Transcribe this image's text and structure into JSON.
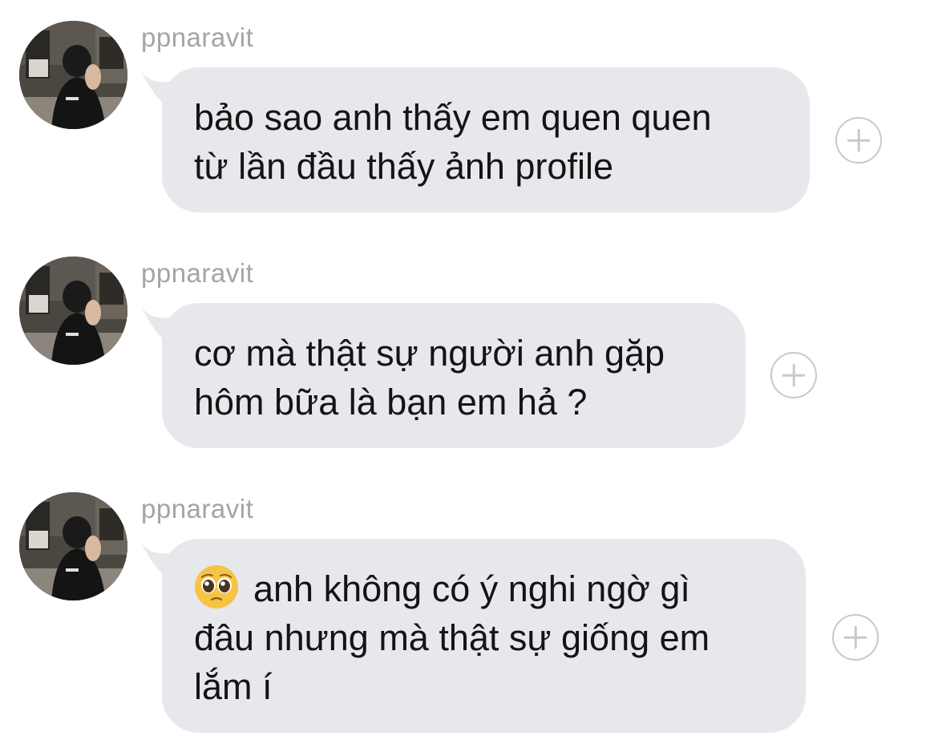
{
  "chat": {
    "messages": [
      {
        "sender": "ppnaravit",
        "text": "bảo sao anh thấy em quen quen\ntừ lần đầu thấy ảnh profile",
        "avatar_icon": "user-avatar-photo",
        "reaction_icon": "add-reaction-icon"
      },
      {
        "sender": "ppnaravit",
        "text": "cơ mà thật sự người anh gặp\nhôm bữa là bạn em hả ?",
        "avatar_icon": "user-avatar-photo",
        "reaction_icon": "add-reaction-icon"
      },
      {
        "sender": "ppnaravit",
        "emoji": "pleading-face-emoji",
        "text": "anh không có ý nghi ngờ gì\nđâu nhưng mà thật sự giống em\nlắm í",
        "avatar_icon": "user-avatar-photo",
        "reaction_icon": "add-reaction-icon"
      }
    ]
  },
  "colors": {
    "background": "#ffffff",
    "bubble": "#e6e8ec",
    "sender_name": "#a4a4a8",
    "message_text": "#141414",
    "plus_icon": "#c7c9cd"
  }
}
